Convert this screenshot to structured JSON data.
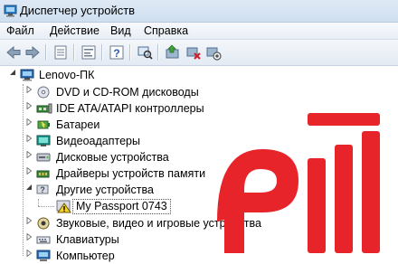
{
  "window": {
    "title": "Диспетчер устройств"
  },
  "menu": [
    {
      "label": "Файл"
    },
    {
      "label": "Действие"
    },
    {
      "label": "Вид"
    },
    {
      "label": "Справка"
    }
  ],
  "toolbar": {
    "icons": [
      "back-icon",
      "forward-icon",
      "properties-icon",
      "help-icon",
      "scan-hardware-icon",
      "update-driver-icon",
      "uninstall-icon",
      "disable-icon"
    ]
  },
  "tree": {
    "root": "Lenovo-ПК",
    "items": [
      {
        "label": "DVD и CD-ROM дисководы",
        "icon": "optical-drive-icon"
      },
      {
        "label": "IDE ATA/ATAPI контроллеры",
        "icon": "ide-controller-icon"
      },
      {
        "label": "Батареи",
        "icon": "battery-icon"
      },
      {
        "label": "Видеоадаптеры",
        "icon": "display-adapter-icon"
      },
      {
        "label": "Дисковые устройства",
        "icon": "disk-drive-icon"
      },
      {
        "label": "Драйверы устройств памяти",
        "icon": "storage-driver-icon"
      },
      {
        "label": "Другие устройства",
        "icon": "other-devices-icon",
        "expanded": true,
        "children": [
          {
            "label": "My Passport 0743",
            "icon": "warning-device-icon",
            "selected": true
          }
        ]
      },
      {
        "label": "Звуковые, видео и игровые устройства",
        "icon": "sound-icon"
      },
      {
        "label": "Клавиатуры",
        "icon": "keyboard-icon"
      },
      {
        "label": "Компьютер",
        "icon": "computer-icon"
      }
    ]
  },
  "colors": {
    "watermark": "#e8242b",
    "selection_border": "#555555"
  }
}
